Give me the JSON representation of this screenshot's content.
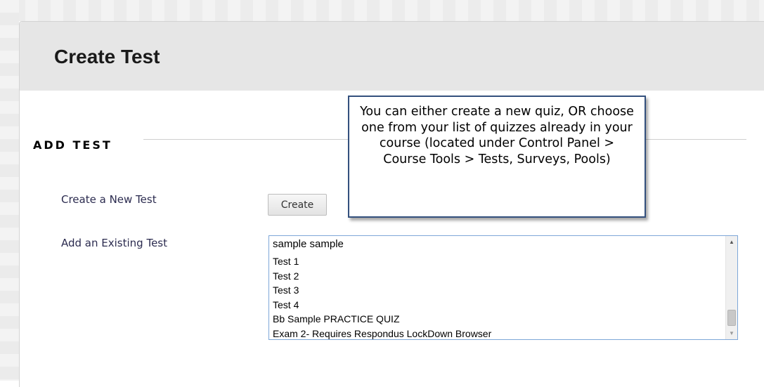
{
  "page": {
    "title": "Create Test"
  },
  "section": {
    "title": "ADD TEST"
  },
  "create_test": {
    "label": "Create a New Test",
    "button_label": "Create"
  },
  "existing_test": {
    "label": "Add an Existing Test",
    "options": [
      "sample sample",
      "Test 1",
      "Test 2",
      "Test 3",
      "Test 4",
      "Bb Sample PRACTICE QUIZ",
      "Exam 2- Requires Respondus LockDown Browser"
    ]
  },
  "callout": {
    "text": "You can either create a new quiz, OR choose one from your list of quizzes already in your course (located under Control Panel > Course Tools > Tests, Surveys, Pools)"
  },
  "icons": {
    "scroll_up": "scroll-up-arrow-icon",
    "scroll_down": "scroll-down-arrow-icon"
  },
  "colors": {
    "header_bg": "#e6e6e6",
    "label_text": "#2b2b4f",
    "listbox_border": "#7ea7d8",
    "callout_border": "#33507d"
  }
}
